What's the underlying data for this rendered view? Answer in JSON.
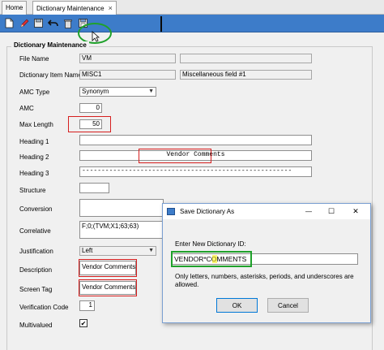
{
  "tabs": [
    {
      "label": "Home"
    },
    {
      "label": "Dictionary Maintenance",
      "close": "×"
    }
  ],
  "toolbar": {
    "icons": [
      "new-icon",
      "edit-icon",
      "save-icon",
      "undo-icon",
      "delete-icon",
      "save-as-icon"
    ],
    "accent": "#3d7cc9"
  },
  "group": {
    "title": "Dictionary Maintenance"
  },
  "form": {
    "file_name": {
      "label": "File Name",
      "value": "VM"
    },
    "item_name": {
      "label": "Dictionary Item Name",
      "value": "MISC1",
      "desc": "Miscellaneous field #1"
    },
    "amc_type": {
      "label": "AMC Type",
      "value": "Synonym"
    },
    "amc": {
      "label": "AMC",
      "value": "0"
    },
    "max_length": {
      "label": "Max Length",
      "value": "50"
    },
    "heading1": {
      "label": "Heading 1",
      "value": ""
    },
    "heading2": {
      "label": "Heading 2",
      "value": "Vendor Comments"
    },
    "heading3": {
      "label": "Heading 3",
      "value": "------------------------------------------------------"
    },
    "structure": {
      "label": "Structure",
      "value": ""
    },
    "conversion": {
      "label": "Conversion",
      "value": ""
    },
    "correlative": {
      "label": "Correlative",
      "value": "F;0;(TVM;X1;63;63)"
    },
    "justification": {
      "label": "Justification",
      "value": "Left"
    },
    "description": {
      "label": "Description",
      "value": "Vendor Comments"
    },
    "screen_tag": {
      "label": "Screen Tag",
      "value": "Vendor Comments"
    },
    "verification_code": {
      "label": "Verification Code",
      "value": "1"
    },
    "multivalued": {
      "label": "Multivalued",
      "checked": "✔"
    }
  },
  "dialog": {
    "title": "Save Dictionary As",
    "prompt": "Enter New Dictionary ID:",
    "value": "VENDOR*COMMENTS",
    "hint": "Only letters, numbers, asterisks, periods, and underscores are allowed.",
    "ok_label": "OK",
    "cancel_label": "Cancel",
    "controls": {
      "minimize": "—",
      "maximize": "☐",
      "close": "✕"
    }
  }
}
